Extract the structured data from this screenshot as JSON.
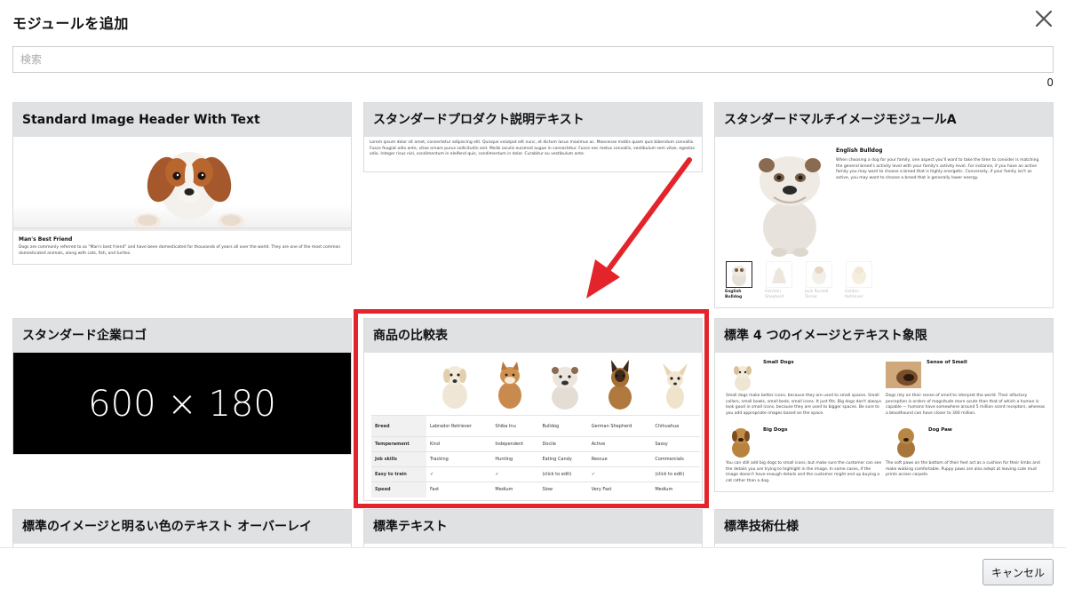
{
  "header": {
    "title": "モジュールを追加",
    "close_icon": "close-icon"
  },
  "search": {
    "placeholder": "検索",
    "value": ""
  },
  "result_count": "0",
  "cards": [
    {
      "title": "Standard Image Header With Text",
      "caption_title": "Man's Best Friend",
      "caption_text": "Dogs are commonly referred to as \"Man's best friend\" and have been domesticated for thousands of years all over the world. They are one of the most common domesticated animals, along with cats, fish, and turtles."
    },
    {
      "title": "スタンダードプロダクト説明テキスト",
      "body_text": "Lorem ipsum dolor sit amet, consectetur adipiscing elit. Quisque volutpat elit nunc, et dictum lacus maximus ac. Maecenas mattis quam quis bibendum convallis. Fusce feugiat odio ante, vitae ornare purus sollicitudin sed. Morbi iaculis euismod augue in consectetur. Fusce nec metus convallis, vestibulum sem vitae, egestas odio. Integer risus nisl, condimentum in eleifend quis, condimentum in dolor. Curabitur eu vestibulum ante."
    },
    {
      "title": "スタンダードマルチイメージモジュールA",
      "heading": "English Bulldog",
      "body_text": "When choosing a dog for your family, one aspect you'll want to take the time to consider is matching the general breed's activity level with your family's activity level. For instance, if you have an active family you may want to choose a breed that is highly energetic. Conversely, if your family isn't as active, you may want to choose a breed that is generally lower energy.",
      "thumbs": [
        {
          "label": "English Bulldog",
          "active": true
        },
        {
          "label": "German Shepherd",
          "active": false
        },
        {
          "label": "Jack Russell Terrier",
          "active": false
        },
        {
          "label": "Golden Retriever",
          "active": false
        }
      ]
    },
    {
      "title": "スタンダード企業ロゴ",
      "logo_text": "600 × 180"
    },
    {
      "title": "商品の比較表",
      "table": [
        [
          "Breed",
          "Labrador Retriever",
          "Shiba Inu",
          "Bulldog",
          "German Shepherd",
          "Chihuahua"
        ],
        [
          "Temperament",
          "Kind",
          "Independent",
          "Docile",
          "Active",
          "Sassy"
        ],
        [
          "Job skills",
          "Tracking",
          "Hunting",
          "Eating Candy",
          "Rescue",
          "Commercials"
        ],
        [
          "Easy to train",
          "✓",
          "✓",
          "(click to edit)",
          "✓",
          "(click to edit)"
        ],
        [
          "Speed",
          "Fast",
          "Medium",
          "Slow",
          "Very Fast",
          "Medium"
        ]
      ]
    },
    {
      "title": "標準 4 つのイメージとテキスト象限",
      "blocks": [
        {
          "heading": "Small Dogs",
          "text": "Small dogs make better icons, because they are used to small spaces. Small collars, small bowls, small beds, small icons. It just fits. Big dogs don't always look good in small icons, because they are used to bigger spaces. Be sure to you add appropriate images based on the space."
        },
        {
          "heading": "Sense of Smell",
          "text": "Dogs rely on their sense of smell to interpret the world. Their olfactory perception is orders of magnitude more acute than that of which a human is capable — humans have somewhere around 5 million scent receptors, whereas a bloodhound can have closer to 300 million."
        },
        {
          "heading": "Big Dogs",
          "text": "You can still add big dogs to small icons, but make sure the customer can see the details you are trying to highlight in the image. In some cases, if the image doesn't have enough details and the customer might end up buying a cat rather than a dog."
        },
        {
          "heading": "Dog Paw",
          "text": "The soft paws on the bottom of their feet act as a cushion for their limbs and make walking comfortable. Puppy paws are also adept at leaving cute mud prints across carpets."
        }
      ]
    },
    {
      "title": "標準のイメージと明るい色のテキスト オーバーレイ"
    },
    {
      "title": "標準テキスト"
    },
    {
      "title": "標準技術仕様"
    }
  ],
  "footer": {
    "cancel_label": "キャンセル"
  },
  "colors": {
    "highlight": "#e3242b",
    "card_header": "#dfe1e3"
  }
}
